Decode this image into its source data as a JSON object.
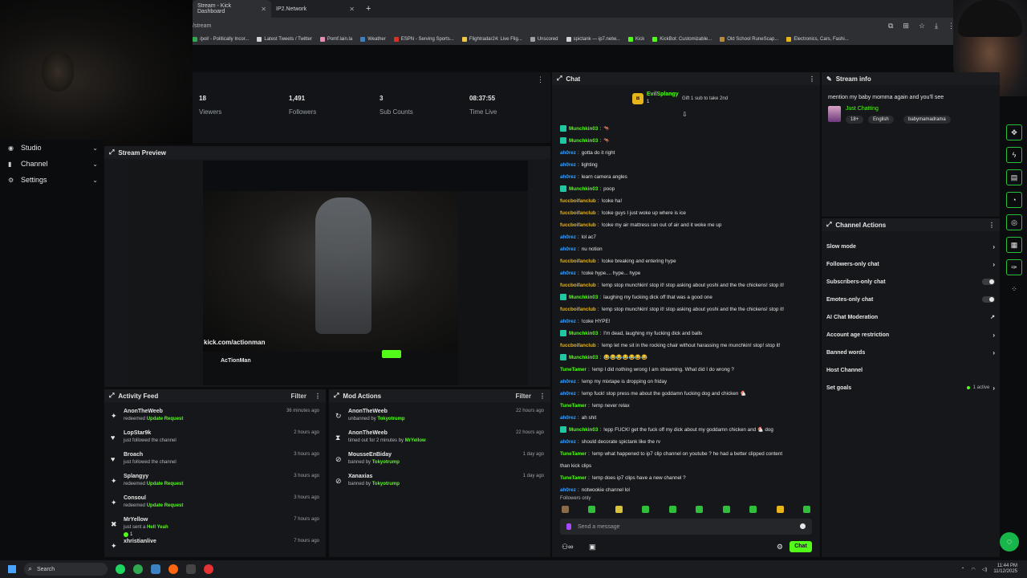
{
  "browser": {
    "tabs": [
      {
        "label": "Stream - Kick Dashboard",
        "active": true
      },
      {
        "label": "IP2.Network",
        "active": false
      }
    ],
    "url": "/stream",
    "bookmarks": [
      "/pol/ - Politically Incor...",
      "Latest Tweets / Twitter",
      "Pomf.lain.la",
      "Weather",
      "ESPN - Serving Sports...",
      "Flightradar24: Live Flig...",
      "Unscored",
      "spictank — ip7.netw...",
      "Kick",
      "KickBot: Customizable...",
      "Old School RuneScap...",
      "Electronics, Cars, Fashi..."
    ]
  },
  "nav": {
    "items": [
      {
        "label": "Studio"
      },
      {
        "label": "Channel"
      },
      {
        "label": "Settings"
      }
    ]
  },
  "stats": [
    {
      "value": "18",
      "label": "Viewers"
    },
    {
      "value": "1,491",
      "label": "Followers"
    },
    {
      "value": "3",
      "label": "Sub Counts"
    },
    {
      "value": "08:37:55",
      "label": "Time Live"
    }
  ],
  "preview": {
    "title": "Stream Preview",
    "overlay_text": "kick.com/actionman",
    "streamer": "AcTionMan"
  },
  "activity": {
    "title": "Activity Feed",
    "filter": "Filter",
    "items": [
      {
        "icon": "gift-icon",
        "name": "AnonTheWeeb",
        "action": "redeemed",
        "highlight": "Update Request",
        "time": "36 minutes ago"
      },
      {
        "icon": "heart-icon",
        "name": "LopStar9k",
        "action": "just followed the channel",
        "highlight": "",
        "time": "2 hours ago"
      },
      {
        "icon": "heart-icon",
        "name": "Broach",
        "action": "just followed the channel",
        "highlight": "",
        "time": "3 hours ago"
      },
      {
        "icon": "gift-icon",
        "name": "Splangyy",
        "action": "redeemed",
        "highlight": "Update Request",
        "time": "3 hours ago"
      },
      {
        "icon": "gift-icon",
        "name": "Consoul",
        "action": "redeemed",
        "highlight": "Update Request",
        "time": "3 hours ago"
      },
      {
        "icon": "kick-icon",
        "name": "MrYellow",
        "action": "just sent a",
        "highlight": "Hell Yeah",
        "time": "7 hours ago"
      },
      {
        "icon": "gift-icon",
        "name": "xhristianlive",
        "action": "",
        "highlight": "",
        "time": "7 hours ago"
      }
    ],
    "tip_badge_count": "1"
  },
  "mod_actions": {
    "title": "Mod Actions",
    "filter": "Filter",
    "items": [
      {
        "icon": "unban-icon",
        "name": "AnonTheWeeb",
        "action": "unbanned by",
        "by": "Tokyotrump",
        "time": "22 hours ago"
      },
      {
        "icon": "hourglass-icon",
        "name": "AnonTheWeeb",
        "action": "timed out for 2 minutes by",
        "by": "MrYellow",
        "time": "22 hours ago"
      },
      {
        "icon": "ban-icon",
        "name": "MousseEnBiday",
        "action": "banned by",
        "by": "Tokyotrump",
        "time": "1 day ago"
      },
      {
        "icon": "ban-icon",
        "name": "Xanaxias",
        "action": "banned by",
        "by": "Tokyotrump",
        "time": "1 day ago"
      }
    ]
  },
  "chat": {
    "title": "Chat",
    "gift": {
      "user": "EvilSplangy",
      "count": "1",
      "text": "Gift 1 sub to take 2nd"
    },
    "messages": [
      {
        "user": "Munchkin03",
        "color": "#53fc18",
        "badge": true,
        "text": "🦘"
      },
      {
        "user": "Munchkin03",
        "color": "#53fc18",
        "badge": true,
        "text": "🦘"
      },
      {
        "user": "ah0rez",
        "color": "#3aa0ff",
        "badge": false,
        "text": "gotta do it right"
      },
      {
        "user": "ah0rez",
        "color": "#3aa0ff",
        "badge": false,
        "text": "lighting"
      },
      {
        "user": "ah0rez",
        "color": "#3aa0ff",
        "badge": false,
        "text": "learn camera angles"
      },
      {
        "user": "Munchkin03",
        "color": "#53fc18",
        "badge": true,
        "text": "poop"
      },
      {
        "user": "fuccboifanclub",
        "color": "#e7b41a",
        "badge": false,
        "text": "!coke ha!"
      },
      {
        "user": "fuccboifanclub",
        "color": "#e7b41a",
        "badge": false,
        "text": "!coke guys I just woke up where is ice"
      },
      {
        "user": "fuccboifanclub",
        "color": "#e7b41a",
        "badge": false,
        "text": "!coke my air mattress ran out of air and it woke me up"
      },
      {
        "user": "ah0rez",
        "color": "#3aa0ff",
        "badge": false,
        "text": "lol ac7"
      },
      {
        "user": "ah0rez",
        "color": "#3aa0ff",
        "badge": false,
        "text": "nu notion"
      },
      {
        "user": "fuccboifanclub",
        "color": "#e7b41a",
        "badge": false,
        "text": "!coke breaking and entering hype"
      },
      {
        "user": "ah0rez",
        "color": "#3aa0ff",
        "badge": false,
        "text": "!coke hype.... hype... hype"
      },
      {
        "user": "fuccboifanclub",
        "color": "#e7b41a",
        "badge": false,
        "text": "!emp stop munchkin! stop it! stop asking about yoshi and the the chickens! stop it!"
      },
      {
        "user": "Munchkin03",
        "color": "#53fc18",
        "badge": true,
        "text": "laughing my fucking dick off that was a good one"
      },
      {
        "user": "fuccboifanclub",
        "color": "#e7b41a",
        "badge": false,
        "text": "!emp stop munchkin! stop it! stop asking about yoshi and the the chickens! stop it!"
      },
      {
        "user": "ah0rez",
        "color": "#3aa0ff",
        "badge": false,
        "text": "!coke HYPE!"
      },
      {
        "user": "Munchkin03",
        "color": "#53fc18",
        "badge": true,
        "text": "I'm dead, laughing my fucking dick and balls"
      },
      {
        "user": "fuccboifanclub",
        "color": "#e7b41a",
        "badge": false,
        "text": "!emp let me sit in the rocking chair without harassing me munchkin! stop! stop it!"
      },
      {
        "user": "Munchkin03",
        "color": "#53fc18",
        "badge": true,
        "text": "😂😂😂😂😂😂😂"
      },
      {
        "user": "TuneTamer",
        "color": "#53fc18",
        "badge": false,
        "text": "!emp I did nothing wrong I am streaming. What did I do wrong ?"
      },
      {
        "user": "ah0rez",
        "color": "#3aa0ff",
        "badge": false,
        "text": "!emp my mixtape is dropping on friday"
      },
      {
        "user": "ah0rez",
        "color": "#3aa0ff",
        "badge": false,
        "text": "!emp fuck! stop press me about the goddamn fucking dog and chicken 🐔"
      },
      {
        "user": "TuneTamer",
        "color": "#53fc18",
        "badge": false,
        "text": "!emp never relax"
      },
      {
        "user": "ah0rez",
        "color": "#3aa0ff",
        "badge": false,
        "text": "ah shit"
      },
      {
        "user": "Munchkin03",
        "color": "#53fc18",
        "badge": true,
        "text": "!epp FUCK! get the fuck off my dick about my goddamn chicken and 🐔 dog"
      },
      {
        "user": "ah0rez",
        "color": "#3aa0ff",
        "badge": false,
        "text": "should decorate spictank like the rv"
      },
      {
        "user": "TuneTamer",
        "color": "#53fc18",
        "badge": false,
        "text": "!emp what happened to ip7 clip channel on youtube ? he had a better clipped content"
      },
      {
        "user": "",
        "color": "#e6e6e6",
        "badge": false,
        "text": "than kick clips"
      },
      {
        "user": "TuneTamer",
        "color": "#53fc18",
        "badge": false,
        "text": "!emp does ip7 clips have a new channel ?"
      },
      {
        "user": "ah0rez",
        "color": "#3aa0ff",
        "badge": false,
        "text": "notwookie channel lol"
      }
    ],
    "followers_only": "Followers only",
    "input_placeholder": "Send a message",
    "send_label": "Chat"
  },
  "stream_info": {
    "title": "Stream info",
    "stream_title": "mention my baby momma again and you'll see",
    "category": "Just Chatting",
    "tags": [
      "18+",
      "English",
      "babymamadrama"
    ]
  },
  "channel_actions": {
    "title": "Channel Actions",
    "items": [
      {
        "label": "Slow mode",
        "control": "chevron"
      },
      {
        "label": "Followers-only chat",
        "control": "chevron"
      },
      {
        "label": "Subscribers-only chat",
        "control": "toggle"
      },
      {
        "label": "Emotes-only chat",
        "control": "toggle"
      },
      {
        "label": "AI Chat Moderation",
        "control": "external"
      },
      {
        "label": "Account age restriction",
        "control": "chevron"
      },
      {
        "label": "Banned words",
        "control": "chevron"
      },
      {
        "label": "Host Channel",
        "control": "none"
      },
      {
        "label": "Set goals",
        "control": "active",
        "note": "1 active"
      }
    ]
  },
  "taskbar": {
    "search_label": "Search",
    "time": "11:44 PM",
    "date": "11/12/2025"
  },
  "colors": {
    "accent": "#53fc18",
    "panel": "#15171a",
    "background": "#0b0c0e"
  }
}
